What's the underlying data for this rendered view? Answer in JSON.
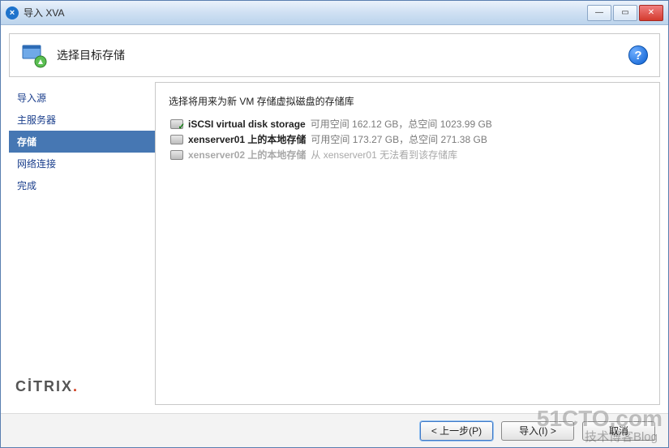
{
  "window": {
    "title": "导入 XVA",
    "icon_glyph": "×"
  },
  "header": {
    "title": "选择目标存储",
    "help_label": "?"
  },
  "sidebar": {
    "steps": [
      {
        "label": "导入源",
        "active": false
      },
      {
        "label": "主服务器",
        "active": false
      },
      {
        "label": "存储",
        "active": true
      },
      {
        "label": "网络连接",
        "active": false
      },
      {
        "label": "完成",
        "active": false
      }
    ],
    "brand": "CİTRIX"
  },
  "content": {
    "title": "选择将用来为新 VM 存储虚拟磁盘的存储库",
    "storages": [
      {
        "name": "iSCSI virtual disk storage",
        "detail": "可用空间 162.12 GB，总空间 1023.99 GB",
        "selected": true,
        "disabled": false
      },
      {
        "name": "xenserver01 上的本地存储",
        "detail": "可用空间 173.27 GB，总空间 271.38 GB",
        "selected": false,
        "disabled": false
      },
      {
        "name": "xenserver02 上的本地存储",
        "detail": "从 xenserver01 无法看到该存储库",
        "selected": false,
        "disabled": true
      }
    ]
  },
  "footer": {
    "prev": "< 上一步(P)",
    "next": "导入(I) >",
    "cancel": "取消"
  },
  "watermark": {
    "line1": "51CTO.com",
    "line2": "技术博客Blog"
  }
}
